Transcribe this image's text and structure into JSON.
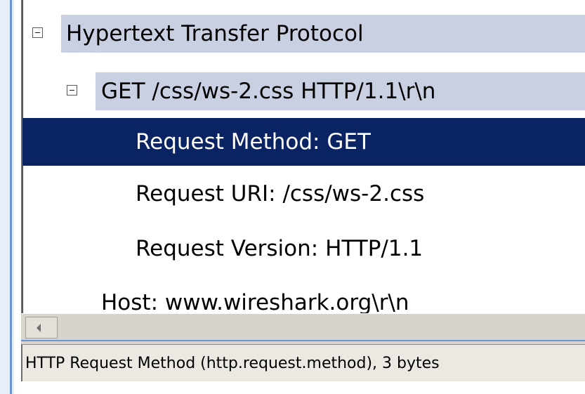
{
  "packet_details": {
    "rows": [
      {
        "label": "Hypertext Transfer Protocol",
        "expanded": true
      },
      {
        "label": "GET /css/ws-2.css HTTP/1.1\\r\\n",
        "expanded": true
      },
      {
        "label": "Request Method: GET",
        "selected": true
      },
      {
        "label": "Request URI: /css/ws-2.css"
      },
      {
        "label": "Request Version: HTTP/1.1"
      },
      {
        "label": "Host: www.wireshark.org\\r\\n"
      }
    ]
  },
  "statusbar": {
    "text": "HTTP Request Method (http.request.method), 3 bytes"
  },
  "colors": {
    "selection": "#0a2463",
    "row_highlight": "#c9d0e2",
    "window_border": "#6d94d4"
  }
}
